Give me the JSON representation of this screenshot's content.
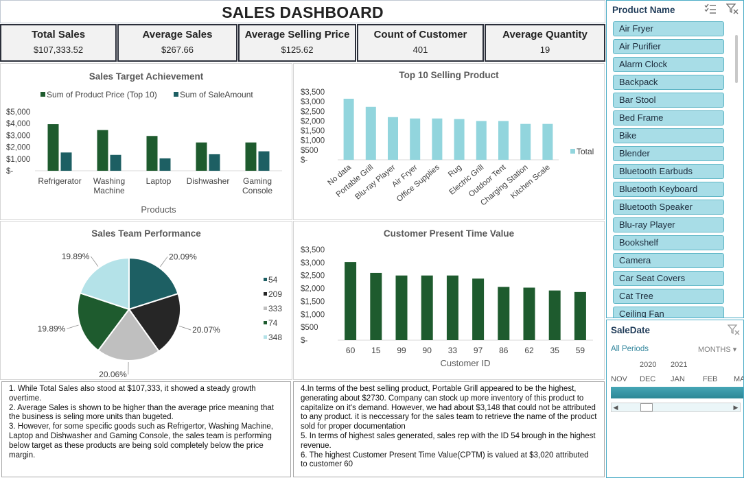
{
  "title": "SALES DASHBOARD",
  "kpis": [
    {
      "label": "Total Sales",
      "value": "$107,333.52"
    },
    {
      "label": "Average Sales",
      "value": "$267.66"
    },
    {
      "label": "Average Selling Price",
      "value": "$125.62"
    },
    {
      "label": "Count of Customer",
      "value": "401"
    },
    {
      "label": "Average Quantity",
      "value": "19"
    }
  ],
  "chart_data": [
    {
      "type": "bar",
      "title": "Sales Target Achievement",
      "xlabel": "Products",
      "ylabel": "",
      "categories": [
        "Refrigerator",
        "Washing Machine",
        "Laptop",
        "Dishwasher",
        "Gaming Console"
      ],
      "series": [
        {
          "name": "Sum of Product Price (Top 10)",
          "color": "#1e5b2e",
          "values": [
            3950,
            3450,
            2950,
            2400,
            2400
          ]
        },
        {
          "name": "Sum of SaleAmount",
          "color": "#1d5f63",
          "values": [
            1550,
            1350,
            1050,
            1400,
            1650
          ]
        }
      ],
      "ylim": [
        0,
        5000
      ],
      "yticks": [
        "$-",
        "$1,000",
        "$2,000",
        "$3,000",
        "$4,000",
        "$5,000"
      ],
      "legend": "top"
    },
    {
      "type": "bar",
      "title": "Top 10 Selling Product",
      "xlabel": "",
      "ylabel": "",
      "categories": [
        "No data",
        "Portable Grill",
        "Blu-ray Player",
        "Air Fryer",
        "Office Supplies",
        "Rug",
        "Electric Grill",
        "Outdoor Tent",
        "Charging Station",
        "Kitchen Scale"
      ],
      "series": [
        {
          "name": "Total",
          "color": "#92d5dd",
          "values": [
            3148,
            2730,
            2200,
            2130,
            2130,
            2100,
            2000,
            2000,
            1850,
            1850
          ]
        }
      ],
      "ylim": [
        0,
        3500
      ],
      "yticks": [
        "$-",
        "$500",
        "$1,000",
        "$1,500",
        "$2,000",
        "$2,500",
        "$3,000",
        "$3,500"
      ],
      "legend": "right"
    },
    {
      "type": "pie",
      "title": "Sales Team Performance",
      "labels": [
        "54",
        "209",
        "333",
        "74",
        "348"
      ],
      "values": [
        20.09,
        20.07,
        20.06,
        19.89,
        19.89
      ],
      "value_labels": [
        "20.09%",
        "20.07%",
        "20.06%",
        "19.89%",
        "19.89%"
      ],
      "colors": [
        "#1d5f63",
        "#262626",
        "#bfbfbf",
        "#1e5b2e",
        "#b4e2e8"
      ],
      "legend": "right"
    },
    {
      "type": "bar",
      "title": "Customer Present Time Value",
      "xlabel": "Customer ID",
      "ylabel": "",
      "categories": [
        "60",
        "15",
        "99",
        "90",
        "33",
        "97",
        "86",
        "62",
        "35",
        "59"
      ],
      "series": [
        {
          "name": "",
          "color": "#1e5b2e",
          "values": [
            3020,
            2600,
            2500,
            2500,
            2500,
            2380,
            2060,
            2030,
            1920,
            1860
          ]
        }
      ],
      "ylim": [
        0,
        3500
      ],
      "yticks": [
        "$-",
        "$500",
        "$1,000",
        "$1,500",
        "$2,000",
        "$2,500",
        "$3,000",
        "$3,500"
      ],
      "legend": "none"
    }
  ],
  "notes_left": [
    "1. While Total Sales also stood at $107,333, it showed a steady growth overtime.",
    "2. Average Sales is shown to be higher than the average price meaning that the business is seling more units than bugeted.",
    "3. However, for some specific goods such as Refrigertor, Washing Machine, Laptop and Dishwasher and Gaming Console, the sales team is performing below target as these products are being sold completely below the price margin."
  ],
  "notes_right": [
    "4.In terms of the best selling product, Portable Grill appeared to be the highest, generating about $2730. Company can stock up more inventory of this product to capitalize on it's demand. However, we had about $3,148 that could not be attributed to any product. it is neccessary for the sales team to retrieve the name of the product sold for proper documentation",
    "5. In terms of highest sales generated, sales rep with the ID 54 brough in the highest revenue.",
    "6. The highest Customer Present Time Value(CPTM) is valued at $3,020 attributed to customer 60"
  ],
  "product_slicer": {
    "title": "Product Name",
    "multiselect_icon": "multi-select-icon",
    "clear_icon": "clear-filter-icon",
    "items": [
      "Air Fryer",
      "Air Purifier",
      "Alarm Clock",
      "Backpack",
      "Bar Stool",
      "Bed Frame",
      "Bike",
      "Blender",
      "Bluetooth Earbuds",
      "Bluetooth Keyboard",
      "Bluetooth Speaker",
      "Blu-ray Player",
      "Bookshelf",
      "Camera",
      "Car Seat Covers",
      "Cat Tree",
      "Ceiling Fan"
    ]
  },
  "timeline": {
    "title": "SaleDate",
    "all_periods": "All Periods",
    "level": "MONTHS",
    "years": [
      "2020",
      "2021"
    ],
    "months": [
      "NOV",
      "DEC",
      "JAN",
      "FEB",
      "MA"
    ]
  }
}
